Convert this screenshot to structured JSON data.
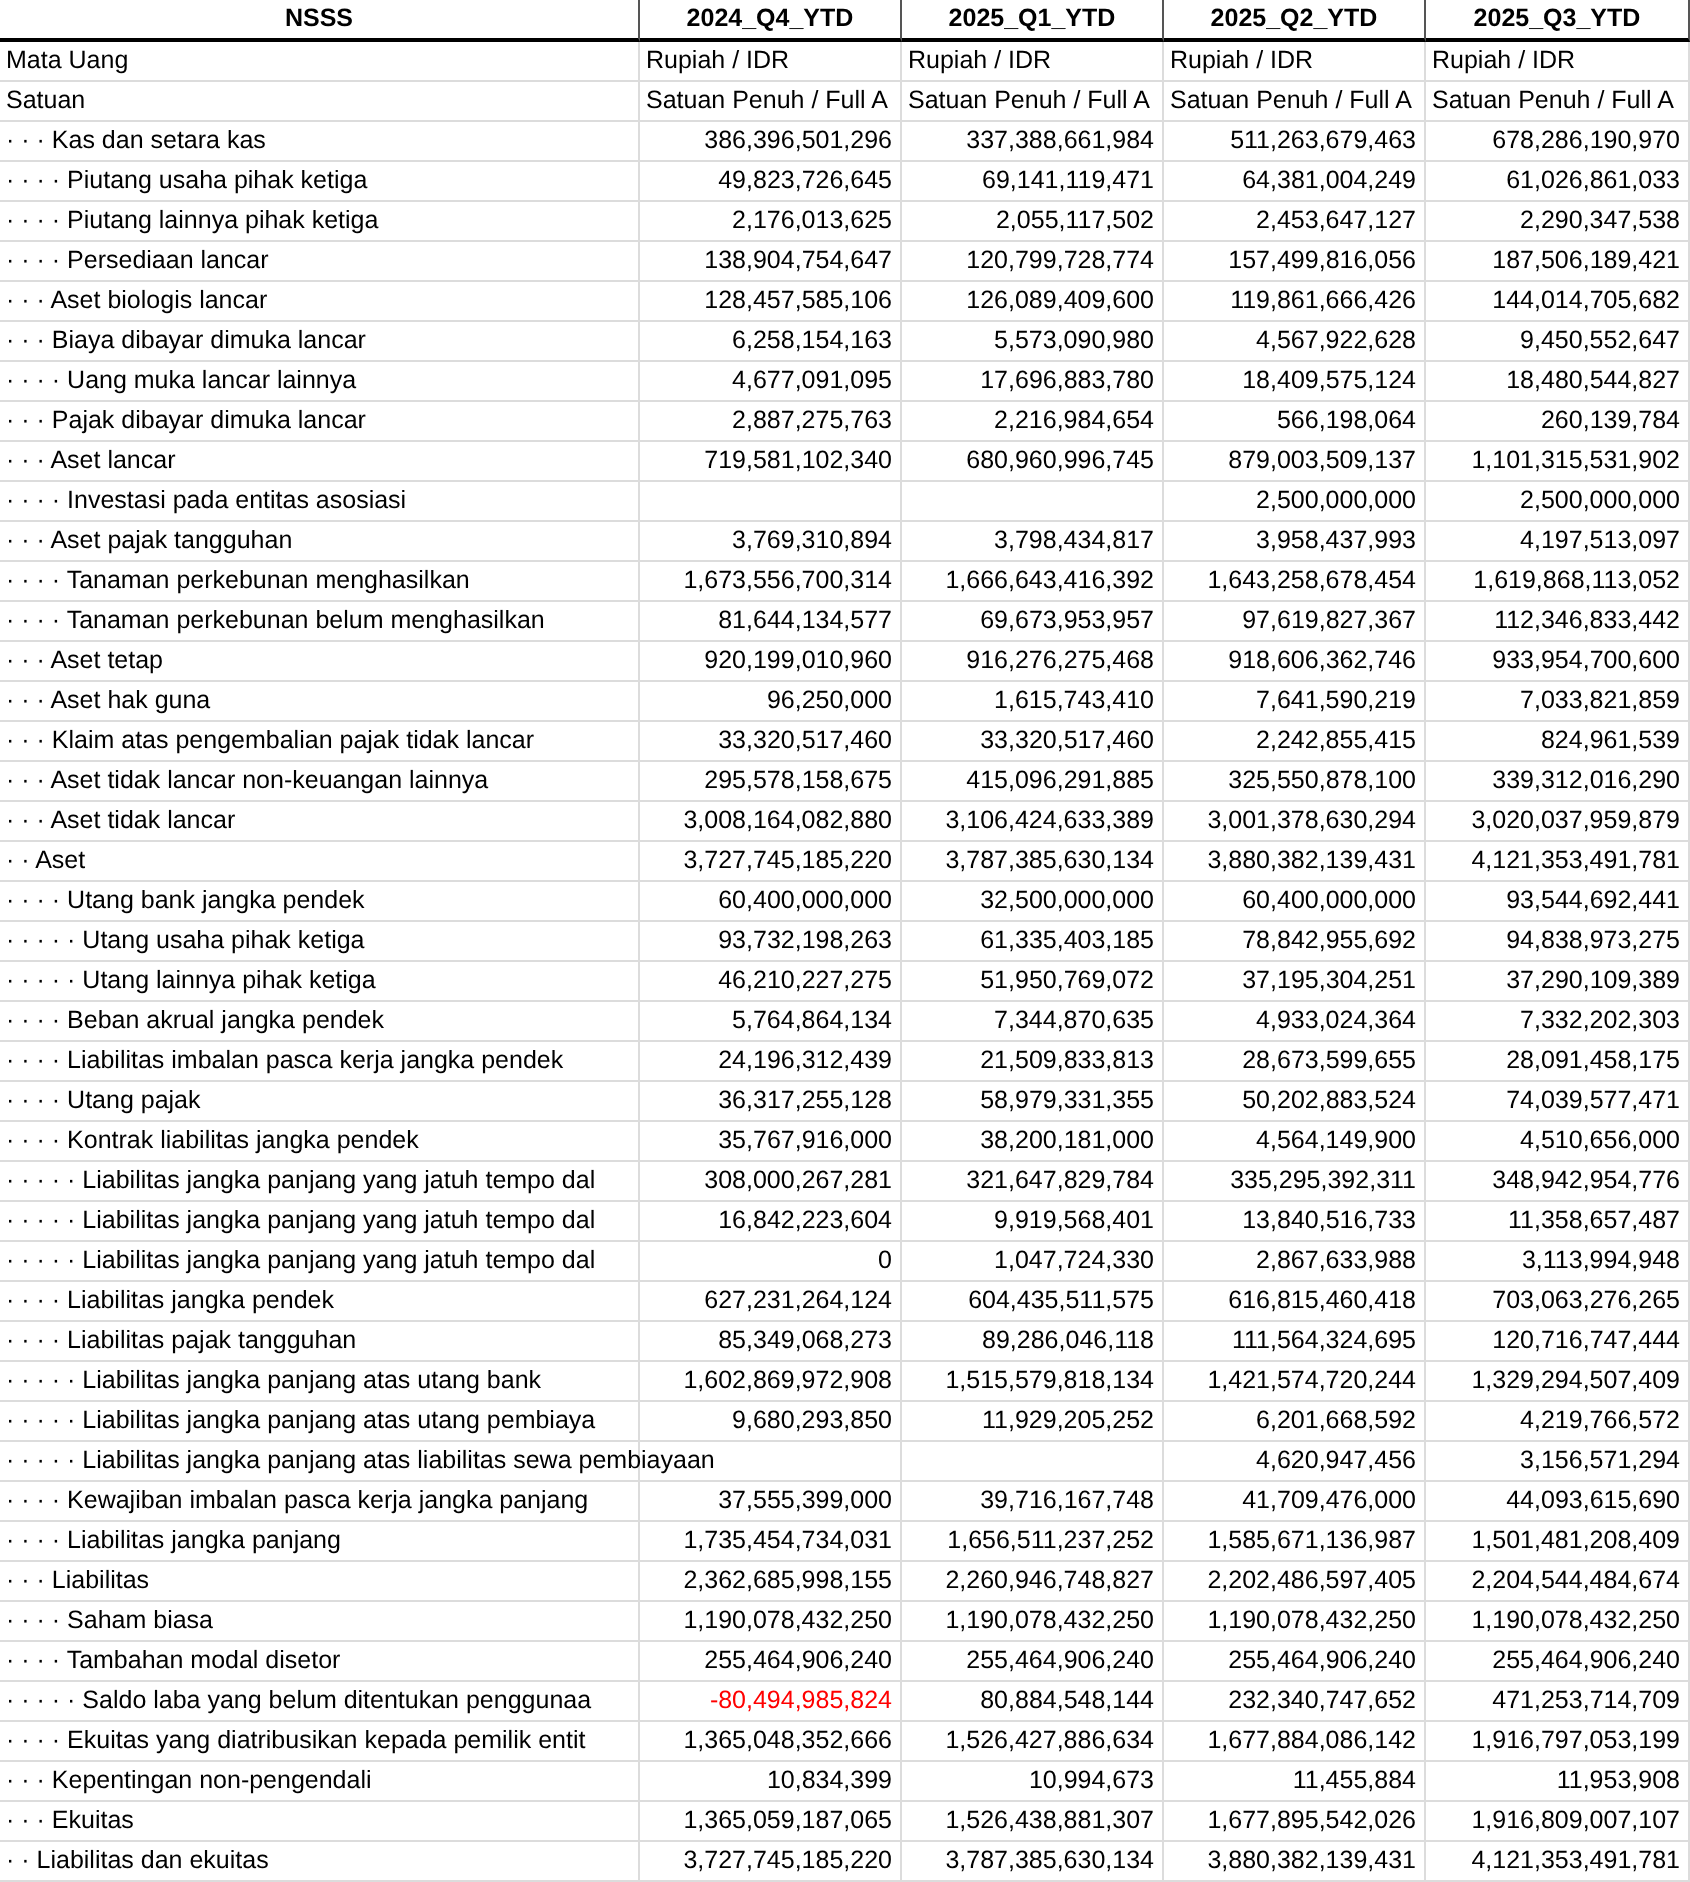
{
  "table": {
    "columns": [
      "NSSS",
      "2024_Q4_YTD",
      "2025_Q1_YTD",
      "2025_Q2_YTD",
      "2025_Q3_YTD"
    ],
    "rows": [
      {
        "kind": "text",
        "label": "Mata Uang",
        "values": [
          "Rupiah / IDR",
          "Rupiah / IDR",
          "Rupiah / IDR",
          "Rupiah / IDR"
        ]
      },
      {
        "kind": "text",
        "label": "Satuan",
        "values": [
          "Satuan Penuh / Full A",
          "Satuan Penuh / Full A",
          "Satuan Penuh / Full A",
          "Satuan Penuh / Full A"
        ]
      },
      {
        "kind": "number",
        "label": "· · · Kas dan setara kas",
        "values": [
          "386,396,501,296",
          "337,388,661,984",
          "511,263,679,463",
          "678,286,190,970"
        ]
      },
      {
        "kind": "number",
        "label": "· · · · Piutang usaha pihak ketiga",
        "values": [
          "49,823,726,645",
          "69,141,119,471",
          "64,381,004,249",
          "61,026,861,033"
        ]
      },
      {
        "kind": "number",
        "label": "· · · · Piutang lainnya pihak ketiga",
        "values": [
          "2,176,013,625",
          "2,055,117,502",
          "2,453,647,127",
          "2,290,347,538"
        ]
      },
      {
        "kind": "number",
        "label": "· · · · Persediaan lancar",
        "values": [
          "138,904,754,647",
          "120,799,728,774",
          "157,499,816,056",
          "187,506,189,421"
        ]
      },
      {
        "kind": "number",
        "label": "· · · Aset biologis lancar",
        "values": [
          "128,457,585,106",
          "126,089,409,600",
          "119,861,666,426",
          "144,014,705,682"
        ]
      },
      {
        "kind": "number",
        "label": "· · · Biaya dibayar dimuka lancar",
        "values": [
          "6,258,154,163",
          "5,573,090,980",
          "4,567,922,628",
          "9,450,552,647"
        ]
      },
      {
        "kind": "number",
        "label": "· · · · Uang muka lancar lainnya",
        "values": [
          "4,677,091,095",
          "17,696,883,780",
          "18,409,575,124",
          "18,480,544,827"
        ]
      },
      {
        "kind": "number",
        "label": "· · · Pajak dibayar dimuka lancar",
        "values": [
          "2,887,275,763",
          "2,216,984,654",
          "566,198,064",
          "260,139,784"
        ]
      },
      {
        "kind": "number",
        "label": "· · · Aset lancar",
        "values": [
          "719,581,102,340",
          "680,960,996,745",
          "879,003,509,137",
          "1,101,315,531,902"
        ]
      },
      {
        "kind": "number",
        "label": "· · · · Investasi pada entitas asosiasi",
        "values": {
          "2025_Q2_YTD": "2,500,000,000",
          "2025_Q3_YTD": "2,500,000,000"
        }
      },
      {
        "kind": "number",
        "label": "· · · Aset pajak tangguhan",
        "values": [
          "3,769,310,894",
          "3,798,434,817",
          "3,958,437,993",
          "4,197,513,097"
        ]
      },
      {
        "kind": "number",
        "label": "· · · · Tanaman perkebunan menghasilkan",
        "values": [
          "1,673,556,700,314",
          "1,666,643,416,392",
          "1,643,258,678,454",
          "1,619,868,113,052"
        ]
      },
      {
        "kind": "number",
        "label": "· · · · Tanaman perkebunan belum menghasilkan",
        "values": [
          "81,644,134,577",
          "69,673,953,957",
          "97,619,827,367",
          "112,346,833,442"
        ]
      },
      {
        "kind": "number",
        "label": "· · · Aset tetap",
        "values": [
          "920,199,010,960",
          "916,276,275,468",
          "918,606,362,746",
          "933,954,700,600"
        ]
      },
      {
        "kind": "number",
        "label": "· · · Aset hak guna",
        "values": [
          "96,250,000",
          "1,615,743,410",
          "7,641,590,219",
          "7,033,821,859"
        ]
      },
      {
        "kind": "number",
        "label": "· · · Klaim atas pengembalian pajak tidak lancar",
        "values": [
          "33,320,517,460",
          "33,320,517,460",
          "2,242,855,415",
          "824,961,539"
        ]
      },
      {
        "kind": "number",
        "label": "· · · Aset tidak lancar non-keuangan lainnya",
        "values": [
          "295,578,158,675",
          "415,096,291,885",
          "325,550,878,100",
          "339,312,016,290"
        ]
      },
      {
        "kind": "number",
        "label": "· · · Aset tidak lancar",
        "values": [
          "3,008,164,082,880",
          "3,106,424,633,389",
          "3,001,378,630,294",
          "3,020,037,959,879"
        ]
      },
      {
        "kind": "number",
        "label": "· · Aset",
        "values": [
          "3,727,745,185,220",
          "3,787,385,630,134",
          "3,880,382,139,431",
          "4,121,353,491,781"
        ]
      },
      {
        "kind": "number",
        "label": "· · · · Utang bank jangka pendek",
        "values": [
          "60,400,000,000",
          "32,500,000,000",
          "60,400,000,000",
          "93,544,692,441"
        ]
      },
      {
        "kind": "number",
        "label": "· · · · · Utang usaha pihak ketiga",
        "values": [
          "93,732,198,263",
          "61,335,403,185",
          "78,842,955,692",
          "94,838,973,275"
        ]
      },
      {
        "kind": "number",
        "label": "· · · · · Utang lainnya pihak ketiga",
        "values": [
          "46,210,227,275",
          "51,950,769,072",
          "37,195,304,251",
          "37,290,109,389"
        ]
      },
      {
        "kind": "number",
        "label": "· · · · Beban akrual jangka pendek",
        "values": [
          "5,764,864,134",
          "7,344,870,635",
          "4,933,024,364",
          "7,332,202,303"
        ]
      },
      {
        "kind": "number",
        "label": "· · · · Liabilitas imbalan pasca kerja jangka pendek",
        "values": [
          "24,196,312,439",
          "21,509,833,813",
          "28,673,599,655",
          "28,091,458,175"
        ]
      },
      {
        "kind": "number",
        "label": "· · · · Utang pajak",
        "values": [
          "36,317,255,128",
          "58,979,331,355",
          "50,202,883,524",
          "74,039,577,471"
        ]
      },
      {
        "kind": "number",
        "label": "· · · · Kontrak liabilitas jangka pendek",
        "values": [
          "35,767,916,000",
          "38,200,181,000",
          "4,564,149,900",
          "4,510,656,000"
        ]
      },
      {
        "kind": "number",
        "label": "· · · · · Liabilitas jangka panjang yang jatuh tempo dal",
        "values": [
          "308,000,267,281",
          "321,647,829,784",
          "335,295,392,311",
          "348,942,954,776"
        ]
      },
      {
        "kind": "number",
        "label": "· · · · · Liabilitas jangka panjang yang jatuh tempo dal",
        "values": [
          "16,842,223,604",
          "9,919,568,401",
          "13,840,516,733",
          "11,358,657,487"
        ]
      },
      {
        "kind": "number",
        "label": "· · · · · Liabilitas jangka panjang yang jatuh tempo dal",
        "values": [
          "0",
          "1,047,724,330",
          "2,867,633,988",
          "3,113,994,948"
        ]
      },
      {
        "kind": "number",
        "label": "· · · · Liabilitas jangka pendek",
        "values": [
          "627,231,264,124",
          "604,435,511,575",
          "616,815,460,418",
          "703,063,276,265"
        ]
      },
      {
        "kind": "number",
        "label": "· · · · Liabilitas pajak tangguhan",
        "values": [
          "85,349,068,273",
          "89,286,046,118",
          "111,564,324,695",
          "120,716,747,444"
        ]
      },
      {
        "kind": "number",
        "label": "· · · · · Liabilitas jangka panjang atas utang bank",
        "values": [
          "1,602,869,972,908",
          "1,515,579,818,134",
          "1,421,574,720,244",
          "1,329,294,507,409"
        ]
      },
      {
        "kind": "number",
        "label": "· · · · · Liabilitas jangka panjang atas utang pembiaya",
        "values": [
          "9,680,293,850",
          "11,929,205,252",
          "6,201,668,592",
          "4,219,766,572"
        ]
      },
      {
        "kind": "number",
        "label": "· · · · · Liabilitas jangka panjang atas liabilitas sewa pembiayaan",
        "values": {
          "2025_Q2_YTD": "4,620,947,456",
          "2025_Q3_YTD": "3,156,571,294"
        }
      },
      {
        "kind": "number",
        "label": "· · · · Kewajiban imbalan pasca kerja jangka panjang",
        "values": [
          "37,555,399,000",
          "39,716,167,748",
          "41,709,476,000",
          "44,093,615,690"
        ]
      },
      {
        "kind": "number",
        "label": "· · · · Liabilitas jangka panjang",
        "values": [
          "1,735,454,734,031",
          "1,656,511,237,252",
          "1,585,671,136,987",
          "1,501,481,208,409"
        ]
      },
      {
        "kind": "number",
        "label": "· · · Liabilitas",
        "values": [
          "2,362,685,998,155",
          "2,260,946,748,827",
          "2,202,486,597,405",
          "2,204,544,484,674"
        ]
      },
      {
        "kind": "number",
        "label": "· · · · Saham biasa",
        "values": [
          "1,190,078,432,250",
          "1,190,078,432,250",
          "1,190,078,432,250",
          "1,190,078,432,250"
        ]
      },
      {
        "kind": "number",
        "label": "· · · · Tambahan modal disetor",
        "values": [
          "255,464,906,240",
          "255,464,906,240",
          "255,464,906,240",
          "255,464,906,240"
        ]
      },
      {
        "kind": "number",
        "label": "· · · · · Saldo laba yang belum ditentukan penggunaa",
        "values": [
          {
            "text": "-80,494,985,824",
            "color": "#ff0000"
          },
          "80,884,548,144",
          "232,340,747,652",
          "471,253,714,709"
        ]
      },
      {
        "kind": "number",
        "label": "· · · · Ekuitas yang diatribusikan kepada pemilik entit",
        "values": [
          "1,365,048,352,666",
          "1,526,427,886,634",
          "1,677,884,086,142",
          "1,916,797,053,199"
        ]
      },
      {
        "kind": "number",
        "label": "· · · Kepentingan non-pengendali",
        "values": [
          "10,834,399",
          "10,994,673",
          "11,455,884",
          "11,953,908"
        ]
      },
      {
        "kind": "number",
        "label": "· · · Ekuitas",
        "values": [
          "1,365,059,187,065",
          "1,526,438,881,307",
          "1,677,895,542,026",
          "1,916,809,007,107"
        ]
      },
      {
        "kind": "number",
        "label": "· · Liabilitas dan ekuitas",
        "values": [
          "3,727,745,185,220",
          "3,787,385,630,134",
          "3,880,382,139,431",
          "4,121,353,491,781"
        ]
      }
    ]
  }
}
